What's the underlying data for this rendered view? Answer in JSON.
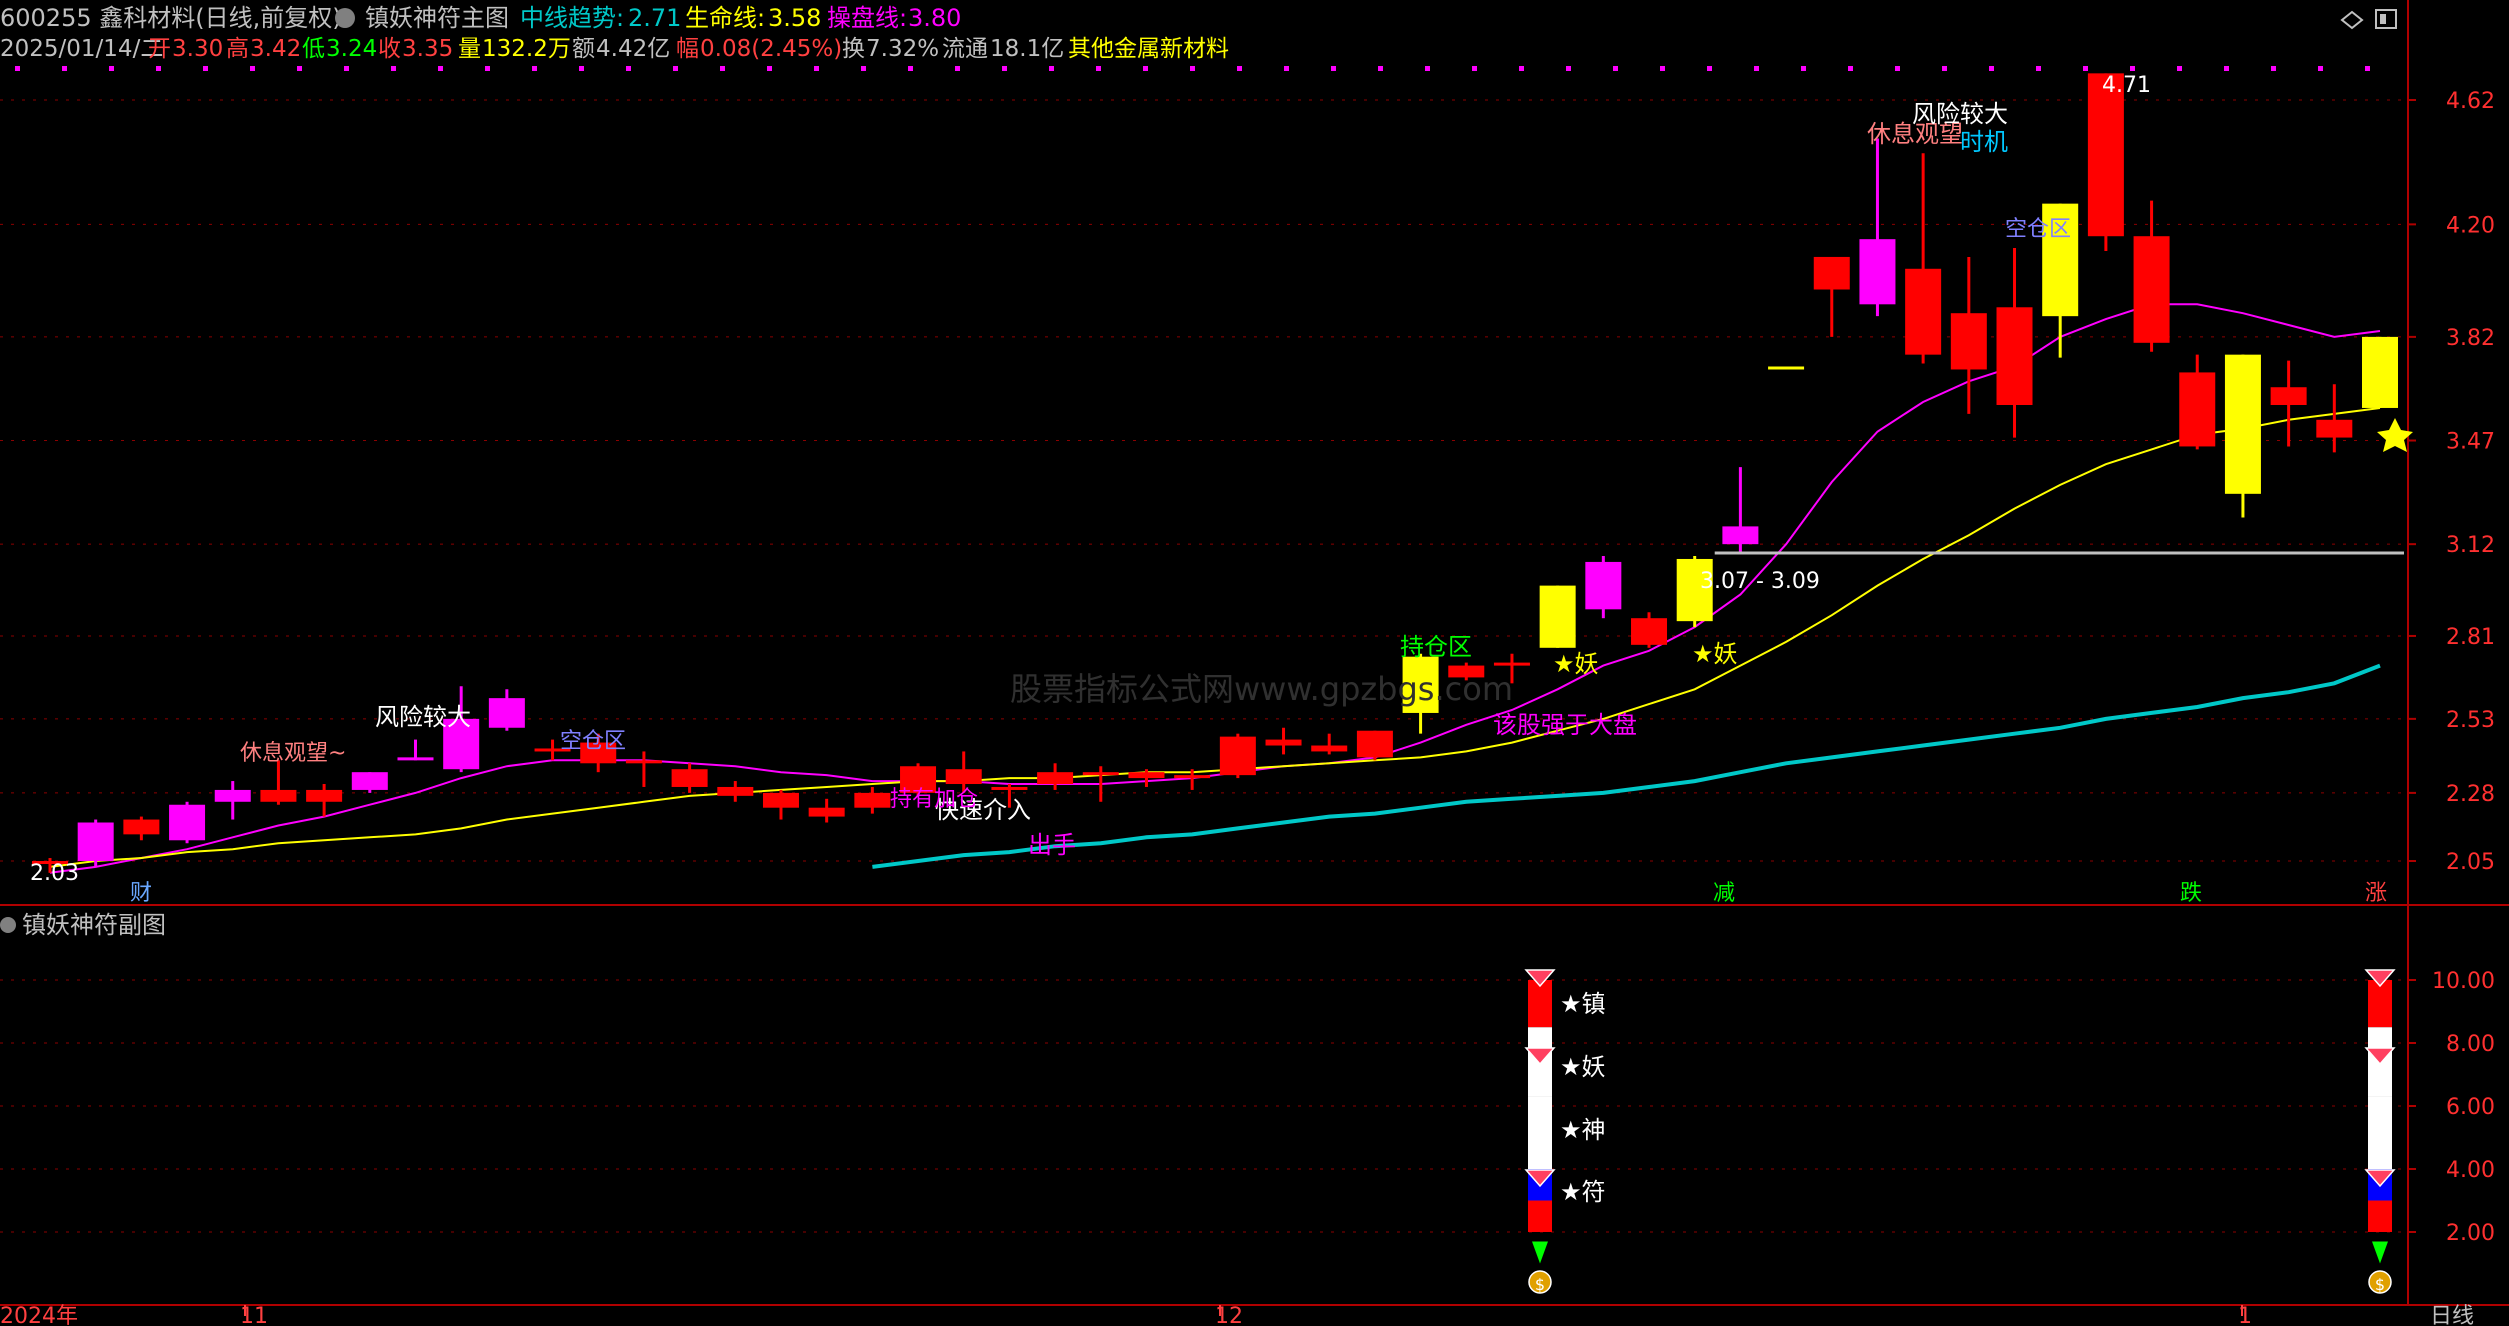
{
  "header": {
    "line1": {
      "code_name": "600255 鑫科材料(日线,前复权)",
      "indicator": "镇妖神符主图",
      "mid_trend_label": "中线趋势:",
      "mid_trend_value": "2.71",
      "life_label": "生命线:",
      "life_value": "3.58",
      "op_label": "操盘线:",
      "op_value": "3.80"
    },
    "line2": {
      "date": "2025/01/14/二",
      "open_label": "开",
      "open": "3.30",
      "high_label": "高",
      "high": "3.42",
      "low_label": "低",
      "low": "3.24",
      "close_label": "收",
      "close": "3.35",
      "vol_label": "量",
      "vol": "132.2万",
      "amt_label": "额",
      "amt": "4.42亿",
      "chg_label": "幅",
      "chg": "0.08(2.45%)",
      "turn_label": "换",
      "turn": "7.32%",
      "float_label": "流通",
      "float": "18.1亿",
      "sector": "其他金属新材料"
    }
  },
  "sub_panel_title": "镇妖神符副图",
  "timeframe": "日线",
  "x_axis": {
    "year": "2024年",
    "m11": "11",
    "m12": "12",
    "m1": "1"
  },
  "colors": {
    "up": "#ff0000",
    "down": "#ff0000",
    "magenta": "#ff00ff",
    "yellow": "#ffff00",
    "cyan": "#00c8c8",
    "grid": "#8b0000",
    "gray": "#c0c0c0"
  },
  "annotations": {
    "low_mark": "2.03",
    "high_mark": "4.71",
    "range": "3.07 - 3.09",
    "cai": "财",
    "jian": "减",
    "die": "跌",
    "zhang": "涨",
    "rest": "休息观望~",
    "risk": "风险较大",
    "empty_zone": "空仓区",
    "fast_in": "快速介入",
    "chushou": "出手",
    "cheng_zhang": "持仓区",
    "strong": "该股强于大盘",
    "yao": "★妖",
    "rest2": "休息观望",
    "chance": "时机",
    "risk2": "风险较大",
    "empty2": "空仓区",
    "chi": "持有加仓"
  },
  "sub_labels": [
    "★镇",
    "★妖",
    "★神",
    "★符"
  ],
  "chart_data": [
    {
      "type": "candlestick",
      "title": "镇妖神符主图",
      "y_ticks": [
        4.62,
        4.2,
        3.82,
        3.47,
        3.12,
        2.81,
        2.53,
        2.28,
        2.05
      ],
      "ylim": [
        1.97,
        4.81
      ],
      "candles": [
        {
          "o": 2.04,
          "h": 2.06,
          "l": 2.01,
          "c": 2.05,
          "color": "up"
        },
        {
          "o": 2.05,
          "h": 2.19,
          "l": 2.03,
          "c": 2.18,
          "color": "magenta"
        },
        {
          "o": 2.14,
          "h": 2.2,
          "l": 2.12,
          "c": 2.19,
          "color": "up"
        },
        {
          "o": 2.12,
          "h": 2.25,
          "l": 2.11,
          "c": 2.24,
          "color": "magenta"
        },
        {
          "o": 2.25,
          "h": 2.32,
          "l": 2.19,
          "c": 2.29,
          "color": "magenta"
        },
        {
          "o": 2.25,
          "h": 2.39,
          "l": 2.24,
          "c": 2.29,
          "color": "up"
        },
        {
          "o": 2.29,
          "h": 2.31,
          "l": 2.2,
          "c": 2.25,
          "color": "up"
        },
        {
          "o": 2.29,
          "h": 2.35,
          "l": 2.28,
          "c": 2.35,
          "color": "magenta"
        },
        {
          "o": 2.4,
          "h": 2.46,
          "l": 2.39,
          "c": 2.4,
          "color": "magenta"
        },
        {
          "o": 2.36,
          "h": 2.64,
          "l": 2.35,
          "c": 2.53,
          "color": "magenta"
        },
        {
          "o": 2.6,
          "h": 2.63,
          "l": 2.49,
          "c": 2.5,
          "color": "magenta"
        },
        {
          "o": 2.43,
          "h": 2.46,
          "l": 2.39,
          "c": 2.43,
          "color": "up"
        },
        {
          "o": 2.45,
          "h": 2.48,
          "l": 2.35,
          "c": 2.38,
          "color": "up"
        },
        {
          "o": 2.39,
          "h": 2.42,
          "l": 2.3,
          "c": 2.39,
          "color": "up"
        },
        {
          "o": 2.36,
          "h": 2.38,
          "l": 2.28,
          "c": 2.3,
          "color": "up"
        },
        {
          "o": 2.3,
          "h": 2.32,
          "l": 2.25,
          "c": 2.27,
          "color": "up"
        },
        {
          "o": 2.28,
          "h": 2.29,
          "l": 2.19,
          "c": 2.23,
          "color": "up"
        },
        {
          "o": 2.23,
          "h": 2.26,
          "l": 2.18,
          "c": 2.2,
          "color": "up"
        },
        {
          "o": 2.23,
          "h": 2.3,
          "l": 2.21,
          "c": 2.28,
          "color": "up"
        },
        {
          "o": 2.28,
          "h": 2.38,
          "l": 2.27,
          "c": 2.37,
          "color": "up"
        },
        {
          "o": 2.36,
          "h": 2.42,
          "l": 2.28,
          "c": 2.31,
          "color": "up"
        },
        {
          "o": 2.29,
          "h": 2.31,
          "l": 2.23,
          "c": 2.3,
          "color": "up"
        },
        {
          "o": 2.31,
          "h": 2.38,
          "l": 2.29,
          "c": 2.35,
          "color": "up"
        },
        {
          "o": 2.35,
          "h": 2.37,
          "l": 2.25,
          "c": 2.34,
          "color": "up"
        },
        {
          "o": 2.33,
          "h": 2.36,
          "l": 2.3,
          "c": 2.35,
          "color": "up"
        },
        {
          "o": 2.34,
          "h": 2.36,
          "l": 2.29,
          "c": 2.34,
          "color": "up"
        },
        {
          "o": 2.34,
          "h": 2.48,
          "l": 2.33,
          "c": 2.47,
          "color": "up"
        },
        {
          "o": 2.46,
          "h": 2.5,
          "l": 2.41,
          "c": 2.44,
          "color": "up"
        },
        {
          "o": 2.44,
          "h": 2.48,
          "l": 2.41,
          "c": 2.42,
          "color": "up"
        },
        {
          "o": 2.4,
          "h": 2.49,
          "l": 2.39,
          "c": 2.49,
          "color": "up"
        },
        {
          "o": 2.55,
          "h": 2.75,
          "l": 2.48,
          "c": 2.74,
          "color": "yellow"
        },
        {
          "o": 2.67,
          "h": 2.72,
          "l": 2.66,
          "c": 2.71,
          "color": "up"
        },
        {
          "o": 2.71,
          "h": 2.75,
          "l": 2.65,
          "c": 2.72,
          "color": "up"
        },
        {
          "o": 2.77,
          "h": 2.98,
          "l": 2.77,
          "c": 2.98,
          "color": "yellow"
        },
        {
          "o": 2.9,
          "h": 3.08,
          "l": 2.87,
          "c": 3.06,
          "color": "magenta"
        },
        {
          "o": 2.78,
          "h": 2.89,
          "l": 2.77,
          "c": 2.87,
          "color": "up"
        },
        {
          "o": 2.86,
          "h": 3.08,
          "l": 2.84,
          "c": 3.07,
          "color": "yellow"
        },
        {
          "o": 3.18,
          "h": 3.38,
          "l": 3.09,
          "c": 3.12,
          "color": "magenta"
        },
        {
          "o": 3.72,
          "h": 3.72,
          "l": 3.72,
          "c": 3.72,
          "color": "yellow"
        },
        {
          "o": 3.98,
          "h": 4.08,
          "l": 3.82,
          "c": 4.09,
          "color": "up"
        },
        {
          "o": 3.93,
          "h": 4.49,
          "l": 3.89,
          "c": 4.15,
          "color": "magenta"
        },
        {
          "o": 4.05,
          "h": 4.44,
          "l": 3.73,
          "c": 3.76,
          "color": "up"
        },
        {
          "o": 3.9,
          "h": 4.09,
          "l": 3.56,
          "c": 3.71,
          "color": "up"
        },
        {
          "o": 3.92,
          "h": 4.12,
          "l": 3.48,
          "c": 3.59,
          "color": "up"
        },
        {
          "o": 3.89,
          "h": 4.27,
          "l": 3.75,
          "c": 4.27,
          "color": "yellow"
        },
        {
          "o": 4.71,
          "h": 4.71,
          "l": 4.11,
          "c": 4.16,
          "color": "up"
        },
        {
          "o": 4.16,
          "h": 4.28,
          "l": 3.77,
          "c": 3.8,
          "color": "up"
        },
        {
          "o": 3.7,
          "h": 3.76,
          "l": 3.44,
          "c": 3.45,
          "color": "up"
        },
        {
          "o": 3.76,
          "h": 3.76,
          "l": 3.21,
          "c": 3.29,
          "color": "yellow"
        },
        {
          "o": 3.65,
          "h": 3.74,
          "l": 3.45,
          "c": 3.59,
          "color": "up"
        },
        {
          "o": 3.54,
          "h": 3.66,
          "l": 3.43,
          "c": 3.48,
          "color": "up"
        },
        {
          "o": 3.58,
          "h": 3.82,
          "l": 3.58,
          "c": 3.82,
          "color": "yellow"
        }
      ],
      "series": [
        {
          "name": "操盘线",
          "color": "#ff00ff",
          "values": [
            2.01,
            2.03,
            2.06,
            2.09,
            2.13,
            2.17,
            2.2,
            2.24,
            2.28,
            2.33,
            2.37,
            2.39,
            2.39,
            2.39,
            2.38,
            2.37,
            2.35,
            2.34,
            2.32,
            2.32,
            2.32,
            2.31,
            2.31,
            2.31,
            2.32,
            2.33,
            2.35,
            2.37,
            2.38,
            2.4,
            2.45,
            2.51,
            2.56,
            2.63,
            2.71,
            2.76,
            2.84,
            2.95,
            3.12,
            3.33,
            3.5,
            3.6,
            3.67,
            3.72,
            3.82,
            3.88,
            3.93,
            3.93,
            3.9,
            3.86,
            3.82,
            3.84
          ]
        },
        {
          "name": "生命线",
          "color": "#ffff00",
          "values": [
            2.03,
            2.05,
            2.06,
            2.08,
            2.09,
            2.11,
            2.12,
            2.13,
            2.14,
            2.16,
            2.19,
            2.21,
            2.23,
            2.25,
            2.27,
            2.28,
            2.29,
            2.3,
            2.31,
            2.32,
            2.32,
            2.33,
            2.33,
            2.34,
            2.35,
            2.35,
            2.36,
            2.37,
            2.38,
            2.39,
            2.4,
            2.42,
            2.45,
            2.49,
            2.53,
            2.58,
            2.63,
            2.71,
            2.79,
            2.88,
            2.98,
            3.07,
            3.15,
            3.24,
            3.32,
            3.39,
            3.44,
            3.49,
            3.51,
            3.54,
            3.56,
            3.58
          ]
        },
        {
          "name": "中线趋势",
          "color": "#00c8c8",
          "values": [
            null,
            null,
            null,
            null,
            null,
            null,
            null,
            null,
            null,
            null,
            null,
            null,
            null,
            null,
            null,
            null,
            null,
            null,
            2.03,
            2.05,
            2.07,
            2.08,
            2.1,
            2.11,
            2.13,
            2.14,
            2.16,
            2.18,
            2.2,
            2.21,
            2.23,
            2.25,
            2.26,
            2.27,
            2.28,
            2.3,
            2.32,
            2.35,
            2.38,
            2.4,
            2.42,
            2.44,
            2.46,
            2.48,
            2.5,
            2.53,
            2.55,
            2.57,
            2.6,
            2.62,
            2.65,
            2.71
          ]
        }
      ]
    },
    {
      "type": "bar",
      "title": "镇妖神符副图",
      "y_ticks": [
        10.0,
        8.0,
        6.0,
        4.0,
        2.0
      ],
      "ylim": [
        0,
        11.5
      ],
      "signal_bars": [
        37,
        51
      ],
      "segments": [
        {
          "from": 8.5,
          "to": 10.0,
          "color": "#ff0000"
        },
        {
          "from": 6.3,
          "to": 8.5,
          "color": "#ffffff"
        },
        {
          "from": 4.0,
          "to": 6.3,
          "color": "#ffffff"
        },
        {
          "from": 3.0,
          "to": 4.0,
          "color": "#0000ff"
        },
        {
          "from": 2.0,
          "to": 3.0,
          "color": "#ff0000"
        }
      ]
    }
  ]
}
